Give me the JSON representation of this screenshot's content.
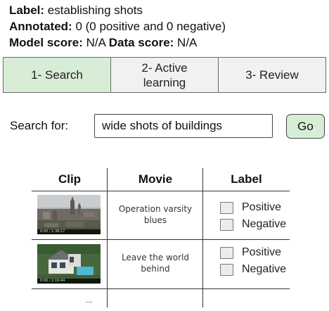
{
  "info": {
    "label_key": "Label:",
    "label_value": " establishing shots",
    "annotated_key": "Annotated:",
    "annotated_value": " 0 (0 positive and 0 negative)",
    "model_score_key": "Model score:",
    "model_score_value": " N/A ",
    "data_score_key": "Data score:",
    "data_score_value": " N/A"
  },
  "tabs": [
    {
      "label": "1- Search",
      "active": true
    },
    {
      "label": "2- Active learning",
      "active": false
    },
    {
      "label": "3- Review",
      "active": false
    }
  ],
  "search": {
    "label": "Search for:",
    "value": "wide shots of buildings",
    "button": "Go"
  },
  "table": {
    "headers": [
      "Clip",
      "Movie",
      "Label"
    ],
    "rows": [
      {
        "movie": "Operation varsity blues",
        "timestamp": "0:00 / 1:38:17",
        "positive": "Positive",
        "negative": "Negative"
      },
      {
        "movie": "Leave the world behind",
        "timestamp": "0:00 / 2:19:44",
        "positive": "Positive",
        "negative": "Negative"
      }
    ],
    "more": "..."
  },
  "colors": {
    "active_tab": "#d8edd6",
    "inactive_tab": "#f1f1f1",
    "go_button": "#d8edd6"
  }
}
